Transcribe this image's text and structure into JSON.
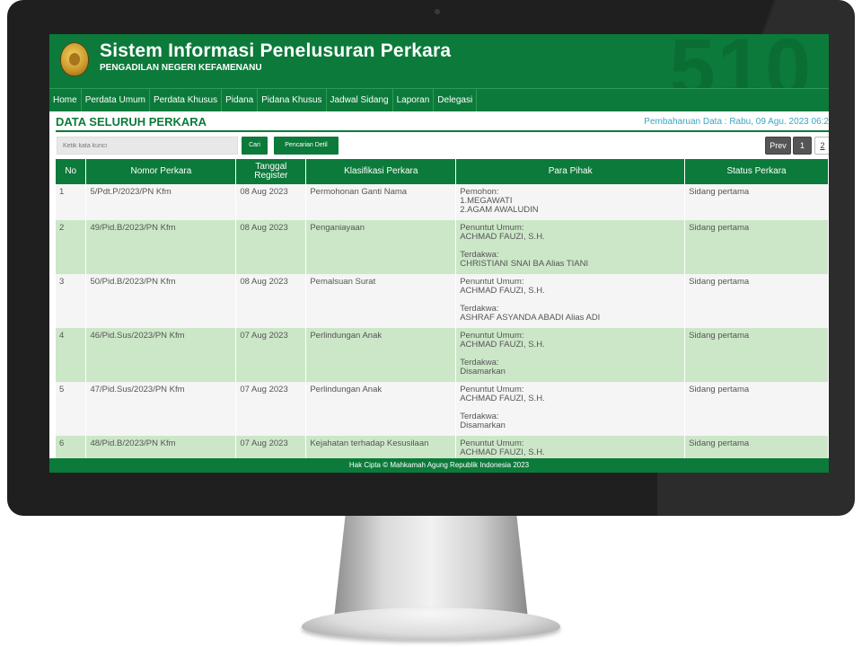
{
  "app": {
    "title": "Sistem Informasi Penelusuran Perkara",
    "subtitle": "PENGADILAN NEGERI KEFAMENANU",
    "background_number": "510",
    "brand_color": "#0c7a3a",
    "row_alt_color": "#cce7c8"
  },
  "nav": [
    {
      "label": "Home"
    },
    {
      "label": "Perdata Umum"
    },
    {
      "label": "Perdata Khusus"
    },
    {
      "label": "Pidana"
    },
    {
      "label": "Pidana Khusus"
    },
    {
      "label": "Jadwal Sidang"
    },
    {
      "label": "Laporan"
    },
    {
      "label": "Delegasi"
    }
  ],
  "page": {
    "title": "DATA SELURUH PERKARA",
    "update_text": "Pembaharuan Data : Rabu, 09 Agu. 2023 06:2"
  },
  "search": {
    "placeholder": "Ketik kata kunci",
    "cari_label": "Cari",
    "detil_label": "Pencarian Detil"
  },
  "pagination": {
    "prev_label": "Prev",
    "pages": [
      "1",
      "2"
    ]
  },
  "table": {
    "headers": [
      "No",
      "Nomor Perkara",
      "Tanggal Register",
      "Klasifikasi Perkara",
      "Para Pihak",
      "Status Perkara"
    ],
    "rows": [
      {
        "no": "1",
        "nomor": "5/Pdt.P/2023/PN Kfm",
        "tanggal": "08 Aug 2023",
        "klasifikasi": "Permohonan Ganti Nama",
        "pihak": [
          "Pemohon:",
          "1.MEGAWATI",
          "2.AGAM AWALUDIN"
        ],
        "status": "Sidang pertama"
      },
      {
        "no": "2",
        "nomor": "49/Pid.B/2023/PN Kfm",
        "tanggal": "08 Aug 2023",
        "klasifikasi": "Penganiayaan",
        "pihak": [
          "Penuntut Umum:",
          "ACHMAD FAUZI, S.H.",
          "",
          "Terdakwa:",
          "CHRISTIANI SNAI BA Alias TIANI"
        ],
        "status": "Sidang pertama"
      },
      {
        "no": "3",
        "nomor": "50/Pid.B/2023/PN Kfm",
        "tanggal": "08 Aug 2023",
        "klasifikasi": "Pemalsuan Surat",
        "pihak": [
          "Penuntut Umum:",
          "ACHMAD FAUZI, S.H.",
          "",
          "Terdakwa:",
          "ASHRAF ASYANDA ABADI Alias ADI"
        ],
        "status": "Sidang pertama"
      },
      {
        "no": "4",
        "nomor": "46/Pid.Sus/2023/PN Kfm",
        "tanggal": "07 Aug 2023",
        "klasifikasi": "Perlindungan Anak",
        "pihak": [
          "Penuntut Umum:",
          "ACHMAD FAUZI, S.H.",
          "",
          "Terdakwa:",
          "Disamarkan"
        ],
        "status": "Sidang pertama"
      },
      {
        "no": "5",
        "nomor": "47/Pid.Sus/2023/PN Kfm",
        "tanggal": "07 Aug 2023",
        "klasifikasi": "Perlindungan Anak",
        "pihak": [
          "Penuntut Umum:",
          "ACHMAD FAUZI, S.H.",
          "",
          "Terdakwa:",
          "Disamarkan"
        ],
        "status": "Sidang pertama"
      },
      {
        "no": "6",
        "nomor": "48/Pid.B/2023/PN Kfm",
        "tanggal": "07 Aug 2023",
        "klasifikasi": "Kejahatan terhadap Kesusilaan",
        "pihak": [
          "Penuntut Umum:",
          "ACHMAD FAUZI, S.H."
        ],
        "status": "Sidang pertama"
      }
    ]
  },
  "footer": {
    "text": "Hak Cipta © Mahkamah Agung Republik Indonesia 2023"
  }
}
